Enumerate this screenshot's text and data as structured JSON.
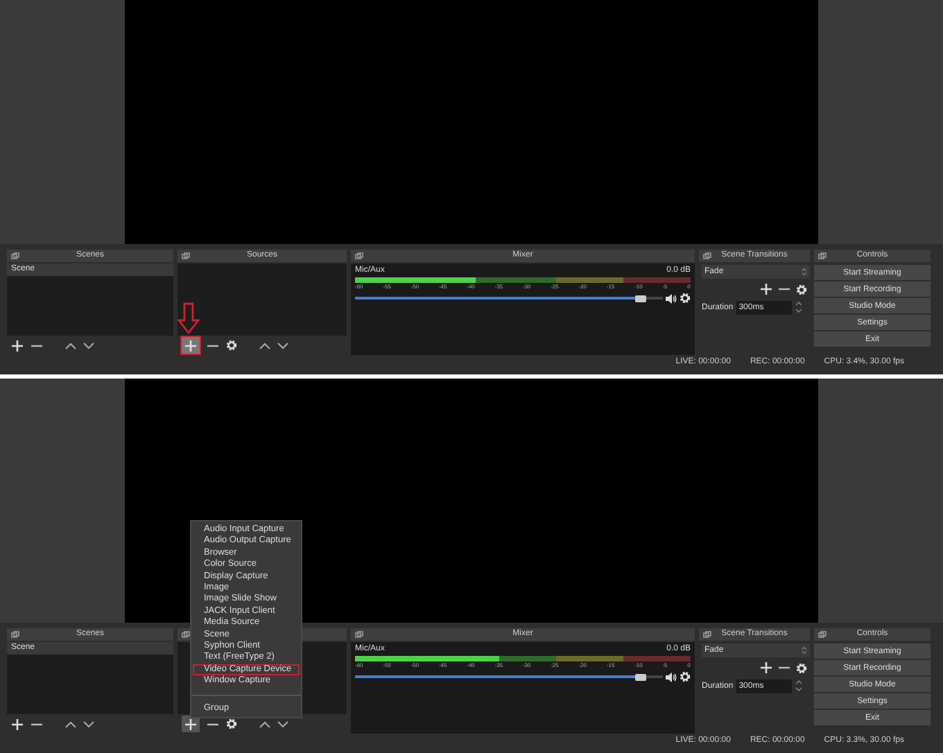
{
  "windows": [
    {
      "scenes": {
        "title": "Scenes",
        "items": [
          {
            "label": "Scene",
            "selected": true
          }
        ]
      },
      "sources": {
        "title": "Sources",
        "add_marked": true,
        "arrow": true
      },
      "mixer": {
        "title": "Mixer",
        "channel": "Mic/Aux",
        "reading": "0.0 dB",
        "meter": {
          "level": 0.36
        },
        "ticks": [
          "-60",
          "-55",
          "-50",
          "-45",
          "-40",
          "-35",
          "-30",
          "-25",
          "-20",
          "-15",
          "-10",
          "-5",
          "0"
        ],
        "fader": {
          "level": 0.93
        }
      },
      "transitions": {
        "title": "Scene Transitions",
        "type": "Fade",
        "duration_label": "Duration",
        "duration": "300ms"
      },
      "controls": {
        "title": "Controls",
        "buttons": [
          "Start Streaming",
          "Start Recording",
          "Studio Mode",
          "Settings",
          "Exit"
        ]
      },
      "status_bar": {
        "live": "LIVE: 00:00:00",
        "rec": "REC: 00:00:00",
        "cpu": "CPU: 3.4%, 30.00 fps"
      }
    },
    {
      "scenes": {
        "title": "Scenes",
        "items": [
          {
            "label": "Scene",
            "selected": true
          }
        ]
      },
      "sources": {
        "add_marked": false
      },
      "mixer": {
        "title": "Mixer",
        "channel": "Mic/Aux",
        "reading": "0.0 dB",
        "meter": {
          "level": 0.43
        },
        "ticks": [
          "-60",
          "-55",
          "-50",
          "-45",
          "-40",
          "-35",
          "-30",
          "-25",
          "-20",
          "-15",
          "-10",
          "-5",
          "0"
        ],
        "fader": {
          "level": 0.93
        }
      },
      "transitions": {
        "title": "Scene Transitions",
        "type": "Fade",
        "duration_label": "Duration",
        "duration": "300ms"
      },
      "controls": {
        "title": "Controls",
        "buttons": [
          "Start Streaming",
          "Start Recording",
          "Studio Mode",
          "Settings",
          "Exit"
        ]
      },
      "status_bar": {
        "live": "LIVE: 00:00:00",
        "rec": "REC: 00:00:00",
        "cpu": "CPU: 3.3%, 30.00 fps"
      },
      "menu": {
        "items": [
          {
            "label": "Audio Input Capture",
            "marked": false
          },
          {
            "label": "Audio Output Capture",
            "marked": false
          },
          {
            "label": "Browser",
            "marked": false
          },
          {
            "label": "Color Source",
            "marked": false
          },
          {
            "label": "Display Capture",
            "marked": false
          },
          {
            "label": "Image",
            "marked": false
          },
          {
            "label": "Image Slide Show",
            "marked": false
          },
          {
            "label": "JACK Input Client",
            "marked": false
          },
          {
            "label": "Media Source",
            "marked": false
          },
          {
            "label": "Scene",
            "marked": false
          },
          {
            "label": "Syphon Client",
            "marked": false
          },
          {
            "label": "Text (FreeType 2)",
            "marked": false
          },
          {
            "label": "Video Capture Device",
            "marked": true
          },
          {
            "label": "Window Capture",
            "marked": false
          }
        ],
        "footer_items": [
          {
            "label": "Group",
            "marked": false
          }
        ]
      }
    }
  ]
}
